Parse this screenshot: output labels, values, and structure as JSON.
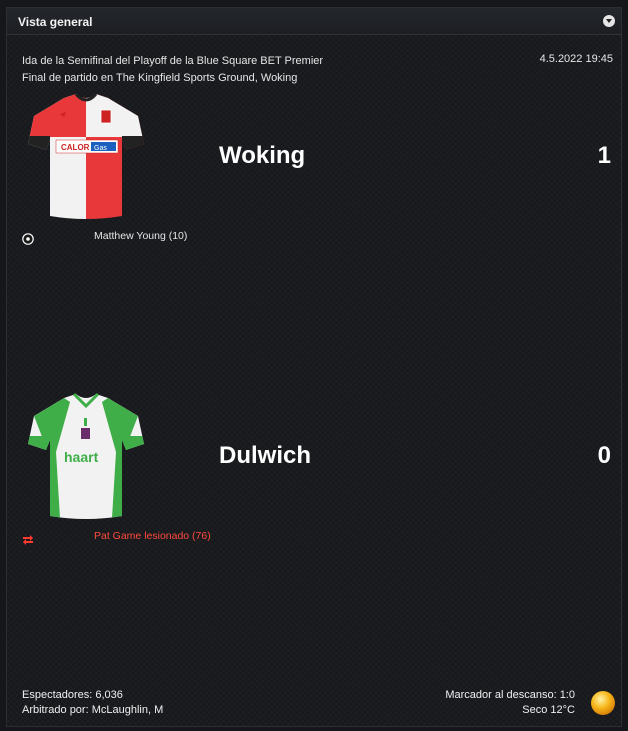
{
  "header": {
    "title": "Vista general"
  },
  "match": {
    "competition": "Ida de la Semifinal del Playoff de la Blue Square BET Premier",
    "venue": "Final de partido en The Kingfield Sports Ground, Woking",
    "datetime": "4.5.2022 19:45"
  },
  "home": {
    "name": "Woking",
    "score": "1",
    "kit_sponsor": "CALOR Gas",
    "kit_colors": [
      "#e8383a",
      "#f2f2f2"
    ],
    "event": {
      "icon": "ball-icon",
      "text": "Matthew Young (10)",
      "color": "#e6e6e6"
    }
  },
  "away": {
    "name": "Dulwich",
    "score": "0",
    "kit_sponsor": "haart",
    "kit_colors": [
      "#f2f2f2",
      "#3fae49"
    ],
    "event": {
      "icon": "injury-icon",
      "text": "Pat Game lesionado (76)",
      "color": "#ff3b30"
    }
  },
  "footer": {
    "attendance": "Espectadores: 6,036",
    "referee": "Arbitrado por: McLaughlin, M",
    "halftime": "Marcador al descanso: 1:0",
    "weather": "Seco 12°C",
    "weather_icon": "sun-icon"
  }
}
